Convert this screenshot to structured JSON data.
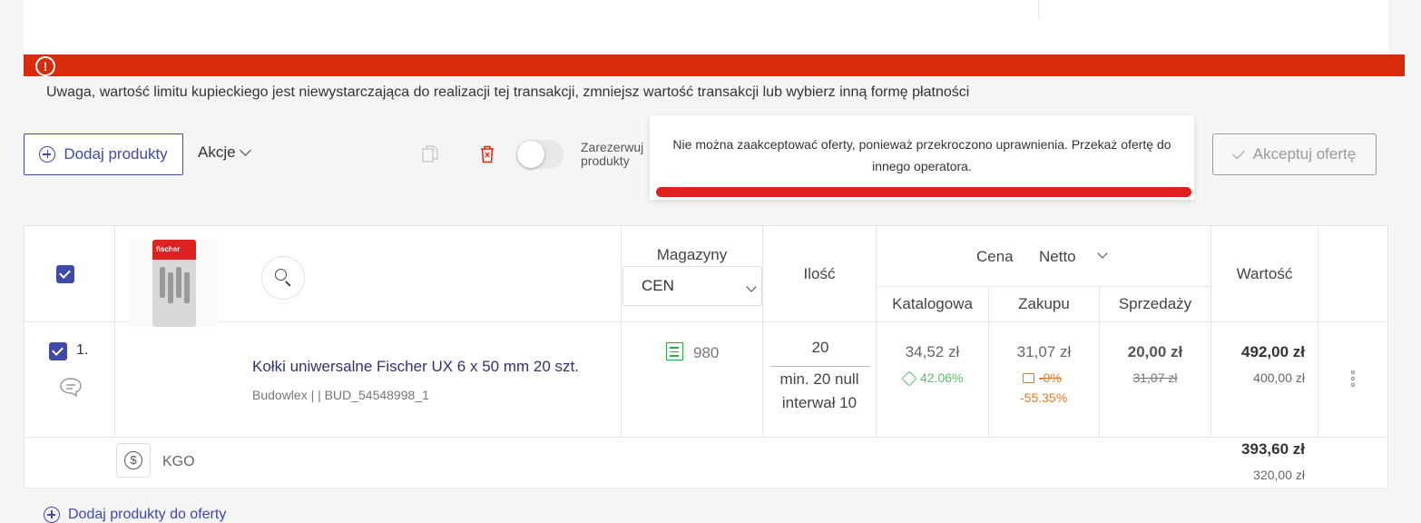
{
  "alert": {
    "icon": "exclamation-circle-icon",
    "message": "Uwaga, wartość limitu kupieckiego jest niewystarczająca do realizacji tej transakcji, zmniejsz wartość transakcji lub wybierz inną formę płatności",
    "color": "#d92b0c"
  },
  "toolbar": {
    "add_products_label": "Dodaj produkty",
    "actions_label": "Akcje",
    "reserve_label": "Zarezerwuj produkty",
    "accept_label": "Akceptuj ofertę"
  },
  "toast": {
    "message": "Nie można zaakceptować oferty, ponieważ przekroczono uprawnienia. Przekaż ofertę do innego operatora."
  },
  "table": {
    "headers": {
      "magazyny": "Magazyny",
      "magazyny_selected": "CEN",
      "ilosc": "Ilość",
      "cena": "Cena",
      "cena_mode": "Netto",
      "katalogowa": "Katalogowa",
      "zakupu": "Zakupu",
      "sprzedazy": "Sprzedaży",
      "wartosc": "Wartość"
    },
    "row": {
      "index": "1.",
      "name": "Kołki uniwersalne Fischer UX 6 x 50 mm 20 szt.",
      "meta": "Budowlex | | BUD_54548998_1",
      "brand_on_pack": "fischer",
      "stock": "980",
      "quantity": "20",
      "min_line": "min. 20 null",
      "interval_line": "interwał 10",
      "catalog_price": "34,52 zł",
      "catalog_discount": "42.06%",
      "purchase_price": "31,07 zł",
      "purchase_old": "-0%",
      "purchase_margin": "-55.35%",
      "sale_price": "20,00 zł",
      "sale_old": "31,07 zł",
      "value_gross": "492,00 zł",
      "value_net": "400,00 zł"
    },
    "kgo": {
      "label": "KGO",
      "value_gross": "393,60 zł",
      "value_net": "320,00 zł"
    }
  },
  "footer": {
    "add_link_label": "Dodaj produkty do oferty"
  },
  "colors": {
    "accent": "#3f4aa8",
    "alert": "#d92b0c",
    "toast_bar": "#e0201e",
    "positive": "#5bbd6a",
    "warning": "#e07a2a"
  }
}
